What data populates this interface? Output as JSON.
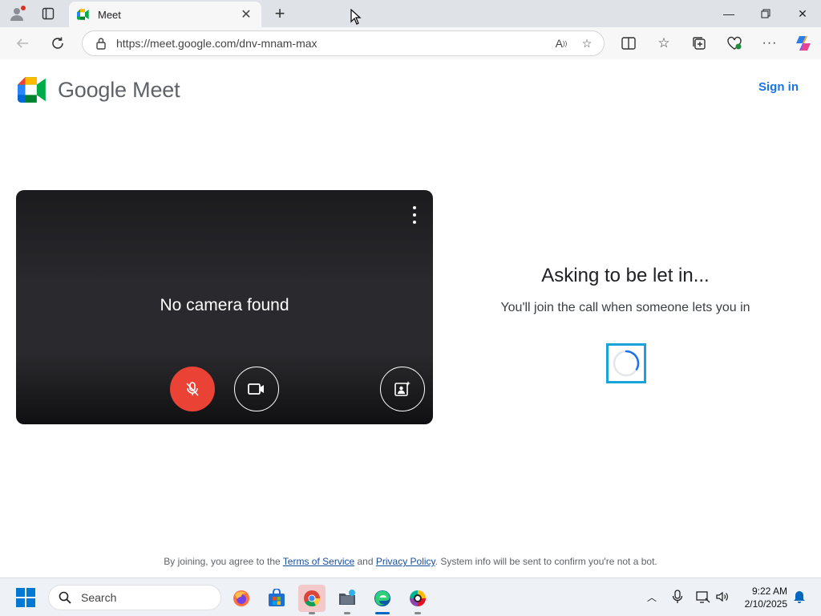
{
  "browser": {
    "tab_title": "Meet",
    "url": "https://meet.google.com/dnv-mnam-max"
  },
  "page": {
    "brand": "Google Meet",
    "sign_in": "Sign in",
    "preview": {
      "status": "No camera found"
    },
    "waiting": {
      "title": "Asking to be let in...",
      "message": "You'll join the call when someone lets you in"
    },
    "footer": {
      "prefix": "By joining, you agree to the ",
      "terms": "Terms of Service",
      "and": " and ",
      "privacy": "Privacy Policy",
      "suffix": ". System info will be sent to confirm you're not a bot."
    }
  },
  "taskbar": {
    "search_label": "Search",
    "time": "9:22 AM",
    "date": "2/10/2025"
  },
  "colors": {
    "accent_blue": "#1a73e8",
    "mic_off_red": "#ea4335",
    "highlight_cyan": "#1aa3d8"
  }
}
